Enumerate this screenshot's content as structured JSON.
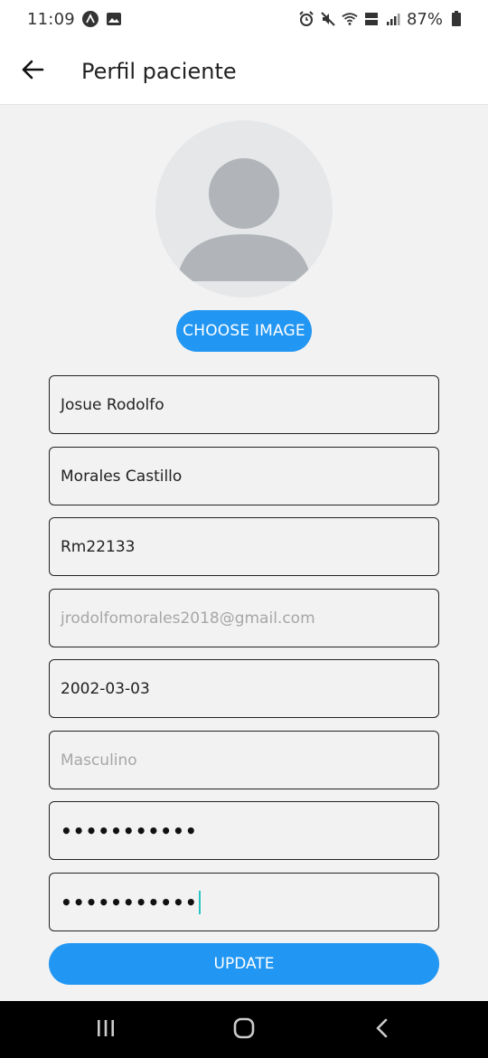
{
  "status_bar": {
    "time": "11:09",
    "battery": "87%"
  },
  "app_bar": {
    "title": "Perfil paciente"
  },
  "profile": {
    "choose_image_label": "CHOOSE IMAGE"
  },
  "form": {
    "first_name": "Josue Rodolfo",
    "last_name": "Morales Castillo",
    "username": "Rm22133",
    "email_placeholder": "jrodolfomorales2018@gmail.com",
    "birth_date": "2002-03-03",
    "gender_placeholder": "Masculino",
    "password_masked": "•••••••••••",
    "confirm_password_masked": "•••••••••••"
  },
  "actions": {
    "update_label": "UPDATE"
  },
  "colors": {
    "accent": "#2196f3",
    "background": "#f2f2f2",
    "caret": "#26c6c6"
  },
  "icons": {
    "back": "arrow-left-icon",
    "avatar": "person-placeholder-icon",
    "nav_recents": "recents-icon",
    "nav_home": "home-icon",
    "nav_back": "nav-back-icon"
  }
}
